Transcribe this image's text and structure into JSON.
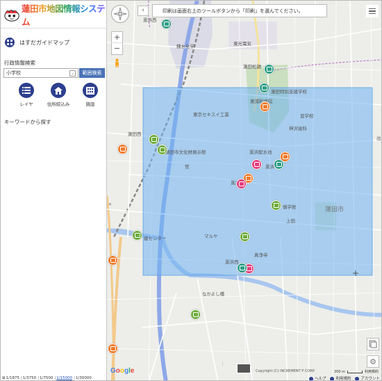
{
  "app": {
    "title": "蓮田市地図情報システム"
  },
  "sidebar": {
    "guide_map": "はすだガイドマップ",
    "admin_search_title": "行政情報検索",
    "school_select": "小学校",
    "range_search": "範囲検索",
    "tools": [
      {
        "label": "レイヤ",
        "icon": "list-icon"
      },
      {
        "label": "住所絞込み",
        "icon": "house-icon"
      },
      {
        "label": "施設",
        "icon": "building-icon"
      }
    ],
    "keyword_label": "キーワードから探す",
    "scales": [
      "1/1875",
      "1/3750",
      "1/7500",
      "1/15000",
      "1/30000"
    ],
    "selected_scale": "1/15000"
  },
  "map": {
    "message": "印刷は画面右上のツールボタンから「印刷」を選んでください。",
    "highlight_color": "#6fb3f0",
    "labels": [
      {
        "text": "黒浜西",
        "pos": "a"
      },
      {
        "text": "積水化学",
        "pos": "b"
      },
      {
        "text": "東光電気",
        "pos": "c"
      },
      {
        "text": "蓮田松韻",
        "pos": "d"
      },
      {
        "text": "蓮田特別支援学校",
        "pos": "e"
      },
      {
        "text": "東浦和病院",
        "pos": "f"
      },
      {
        "text": "東京セキスイ工業",
        "pos": "g"
      },
      {
        "text": "蓮田西",
        "pos": "h"
      },
      {
        "text": "蓮田市文化財展示館",
        "pos": "i"
      },
      {
        "text": "黒浜配水池",
        "pos": "j"
      },
      {
        "text": "黒浜",
        "pos": "k"
      },
      {
        "text": "黒浜",
        "pos": "l"
      },
      {
        "text": "慎学館",
        "pos": "m"
      },
      {
        "text": "上田",
        "pos": "n"
      },
      {
        "text": "建センター",
        "pos": "o"
      },
      {
        "text": "マルヤ",
        "pos": "p"
      },
      {
        "text": "真浄寺",
        "pos": "q"
      },
      {
        "text": "黒浜西",
        "pos": "r"
      },
      {
        "text": "なかよし橋",
        "pos": "s"
      },
      {
        "text": "神沢歯科",
        "pos": "t"
      },
      {
        "text": "宮",
        "pos": "u"
      },
      {
        "text": "蓮田市",
        "pos": "v"
      },
      {
        "text": "出",
        "pos": "w"
      },
      {
        "text": "習学校",
        "pos": "x"
      }
    ],
    "google": "Google",
    "copyright": "Copyright (C) INCREMENT P CORP.",
    "scale_text": "200 m",
    "terms": "利用規約"
  },
  "footer": {
    "help": "ヘルプ",
    "terms": "利用規約",
    "account": "アカウント"
  }
}
